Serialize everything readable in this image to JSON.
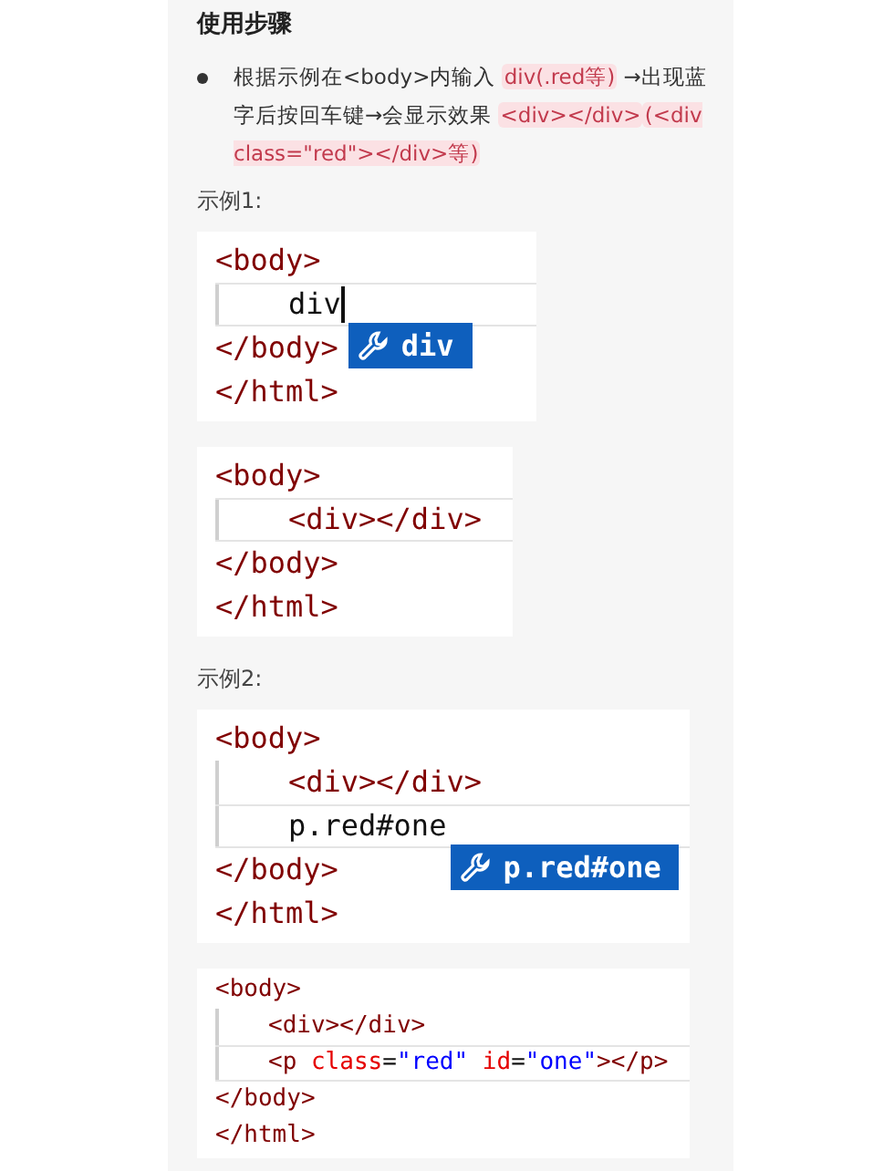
{
  "heading": "使用步骤",
  "bullet": [
    {
      "text": "根据示例在<body>内输入 ",
      "highlighted": false
    },
    {
      "text": "div(.red等)",
      "highlighted": true
    },
    {
      "text": " →出现蓝字后按回车键→会显示效果 ",
      "highlighted": false
    },
    {
      "text": "<div></div>",
      "highlighted": true
    },
    {
      "text": "(<div class=\"red\"></div>等)",
      "highlighted": true
    }
  ],
  "examples": [
    {
      "label": "示例1:",
      "blocks": [
        {
          "kind": "editor",
          "lines": [
            {
              "indented": false,
              "current": false,
              "cursor": false,
              "tokens": [
                {
                  "kind": "tag",
                  "text": "<body>"
                }
              ]
            },
            {
              "indented": true,
              "current": true,
              "cursor": true,
              "suggestion": "div",
              "tokens": [
                {
                  "kind": "text",
                  "text": "div"
                }
              ]
            },
            {
              "indented": false,
              "current": false,
              "cursor": false,
              "tokens": [
                {
                  "kind": "tag",
                  "text": "</body>"
                }
              ]
            },
            {
              "indented": false,
              "current": false,
              "cursor": false,
              "tokens": [
                {
                  "kind": "tag",
                  "text": "</html>"
                }
              ]
            }
          ]
        },
        {
          "kind": "editor",
          "lines": [
            {
              "indented": false,
              "current": false,
              "cursor": false,
              "tokens": [
                {
                  "kind": "tag",
                  "text": "<body>"
                }
              ]
            },
            {
              "indented": true,
              "current": true,
              "cursor": false,
              "tokens": [
                {
                  "kind": "tag",
                  "text": "<div></div>"
                }
              ]
            },
            {
              "indented": false,
              "current": false,
              "cursor": false,
              "tokens": [
                {
                  "kind": "tag",
                  "text": "</body>"
                }
              ]
            },
            {
              "indented": false,
              "current": false,
              "cursor": false,
              "tokens": [
                {
                  "kind": "tag",
                  "text": "</html>"
                }
              ]
            }
          ]
        }
      ]
    },
    {
      "label": "示例2:",
      "blocks": [
        {
          "kind": "editor",
          "lines": [
            {
              "indented": false,
              "current": false,
              "cursor": false,
              "tokens": [
                {
                  "kind": "tag",
                  "text": "<body>"
                }
              ]
            },
            {
              "indented": true,
              "current": false,
              "cursor": false,
              "tokens": [
                {
                  "kind": "tag",
                  "text": "<div></div>"
                }
              ]
            },
            {
              "indented": true,
              "current": true,
              "cursor": false,
              "suggestion": "p.red#one",
              "tokens": [
                {
                  "kind": "text",
                  "text": "p.red#one"
                }
              ]
            },
            {
              "indented": false,
              "current": false,
              "cursor": false,
              "tokens": [
                {
                  "kind": "tag",
                  "text": "</body>"
                }
              ]
            },
            {
              "indented": false,
              "current": false,
              "cursor": false,
              "tokens": [
                {
                  "kind": "tag",
                  "text": "</html>"
                }
              ]
            }
          ]
        },
        {
          "kind": "preview",
          "lines": [
            {
              "indented": false,
              "current": false,
              "cursor": false,
              "tokens": [
                {
                  "kind": "tag",
                  "text": "<body>"
                }
              ]
            },
            {
              "indented": true,
              "current": false,
              "cursor": false,
              "tokens": [
                {
                  "kind": "tag",
                  "text": "<div></div>"
                }
              ]
            },
            {
              "indented": true,
              "current": true,
              "cursor": false,
              "tokens": [
                {
                  "kind": "tag",
                  "text": "<p"
                },
                {
                  "kind": "attr",
                  "text": " class"
                },
                {
                  "kind": "text",
                  "text": "="
                },
                {
                  "kind": "value",
                  "text": "\"red\""
                },
                {
                  "kind": "attr",
                  "text": " id"
                },
                {
                  "kind": "text",
                  "text": "="
                },
                {
                  "kind": "value",
                  "text": "\"one\""
                },
                {
                  "kind": "tag",
                  "text": "></p>"
                }
              ]
            },
            {
              "indented": false,
              "current": false,
              "cursor": false,
              "tokens": [
                {
                  "kind": "tag",
                  "text": "</body>"
                }
              ]
            },
            {
              "indented": false,
              "current": false,
              "cursor": false,
              "tokens": [
                {
                  "kind": "tag",
                  "text": "</html>"
                }
              ]
            }
          ]
        }
      ]
    }
  ]
}
